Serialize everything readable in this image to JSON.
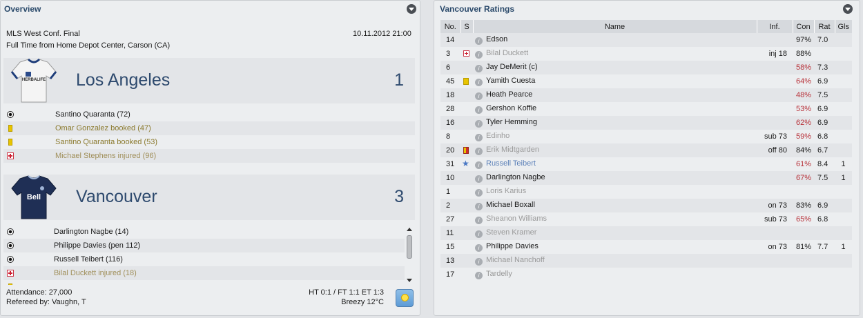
{
  "overview": {
    "title": "Overview",
    "competition": "MLS West Conf. Final",
    "datetime": "10.11.2012 21:00",
    "result_text": "Full Time from Home Depot Center, Carson (CA)",
    "home": {
      "name": "Los Angeles",
      "score": "1",
      "kit_text": "HERBALIFE",
      "events": [
        {
          "type": "goal",
          "text": "Santino Quaranta (72)"
        },
        {
          "type": "booking",
          "text": "Omar Gonzalez booked (47)"
        },
        {
          "type": "booking",
          "text": "Santino Quaranta booked (53)"
        },
        {
          "type": "injury",
          "text": "Michael Stephens injured (96)"
        }
      ]
    },
    "away": {
      "name": "Vancouver",
      "score": "3",
      "kit_text": "Bell",
      "events": [
        {
          "type": "goal",
          "text": "Darlington Nagbe (14)"
        },
        {
          "type": "goal",
          "text": "Philippe Davies (pen 112)"
        },
        {
          "type": "goal",
          "text": "Russell Teibert (116)"
        },
        {
          "type": "injury",
          "text": "Bilal Duckett injured (18)"
        }
      ]
    },
    "attendance": "Attendance: 27,000",
    "referee": "Refereed by: Vaughn, T",
    "scoreline": "HT 0:1 / FT 1:1 ET 1:3",
    "weather": "Breezy 12°C",
    "weather_icon": "sun-icon"
  },
  "ratings": {
    "title": "Vancouver Ratings",
    "columns": [
      "No.",
      "S",
      "Name",
      "Inf.",
      "Con",
      "Rat",
      "Gls"
    ],
    "rows": [
      {
        "no": "14",
        "s": "",
        "name": "Edson",
        "inf": "",
        "con": "97%",
        "rat": "7.0",
        "gls": "",
        "dim": false,
        "low": false
      },
      {
        "no": "3",
        "s": "injury",
        "name": "Bilal Duckett",
        "inf": "inj 18",
        "con": "88%",
        "rat": "",
        "gls": "",
        "dim": true,
        "low": false
      },
      {
        "no": "6",
        "s": "",
        "name": "Jay DeMerit (c)",
        "inf": "",
        "con": "58%",
        "rat": "7.3",
        "gls": "",
        "dim": false,
        "low": true
      },
      {
        "no": "45",
        "s": "yellow",
        "name": "Yamith Cuesta",
        "inf": "",
        "con": "64%",
        "rat": "6.9",
        "gls": "",
        "dim": false,
        "low": true
      },
      {
        "no": "18",
        "s": "",
        "name": "Heath Pearce",
        "inf": "",
        "con": "48%",
        "rat": "7.5",
        "gls": "",
        "dim": false,
        "low": true
      },
      {
        "no": "28",
        "s": "",
        "name": "Gershon Koffie",
        "inf": "",
        "con": "53%",
        "rat": "6.9",
        "gls": "",
        "dim": false,
        "low": true
      },
      {
        "no": "16",
        "s": "",
        "name": "Tyler Hemming",
        "inf": "",
        "con": "62%",
        "rat": "6.9",
        "gls": "",
        "dim": false,
        "low": true
      },
      {
        "no": "8",
        "s": "",
        "name": "Edinho",
        "inf": "sub 73",
        "con": "59%",
        "rat": "6.8",
        "gls": "",
        "dim": true,
        "low": true
      },
      {
        "no": "20",
        "s": "yellow-red",
        "name": "Erik Midtgarden",
        "inf": "off 80",
        "con": "84%",
        "rat": "6.7",
        "gls": "",
        "dim": true,
        "low": false
      },
      {
        "no": "31",
        "s": "star",
        "name": "Russell Teibert",
        "inf": "",
        "con": "61%",
        "rat": "8.4",
        "gls": "1",
        "dim": false,
        "low": true,
        "motm": true
      },
      {
        "no": "10",
        "s": "",
        "name": "Darlington Nagbe",
        "inf": "",
        "con": "67%",
        "rat": "7.5",
        "gls": "1",
        "dim": false,
        "low": true
      },
      {
        "no": "1",
        "s": "",
        "name": "Loris Karius",
        "inf": "",
        "con": "",
        "rat": "",
        "gls": "",
        "dim": true,
        "low": false
      },
      {
        "no": "2",
        "s": "",
        "name": "Michael Boxall",
        "inf": "on 73",
        "con": "83%",
        "rat": "6.9",
        "gls": "",
        "dim": false,
        "low": false
      },
      {
        "no": "27",
        "s": "",
        "name": "Sheanon Williams",
        "inf": "sub 73",
        "con": "65%",
        "rat": "6.8",
        "gls": "",
        "dim": true,
        "low": true
      },
      {
        "no": "11",
        "s": "",
        "name": "Steven Kramer",
        "inf": "",
        "con": "",
        "rat": "",
        "gls": "",
        "dim": true,
        "low": false
      },
      {
        "no": "15",
        "s": "",
        "name": "Philippe Davies",
        "inf": "on 73",
        "con": "81%",
        "rat": "7.7",
        "gls": "1",
        "dim": false,
        "low": false
      },
      {
        "no": "13",
        "s": "",
        "name": "Michael Nanchoff",
        "inf": "",
        "con": "",
        "rat": "",
        "gls": "",
        "dim": true,
        "low": false
      },
      {
        "no": "17",
        "s": "",
        "name": "Tardelly",
        "inf": "",
        "con": "",
        "rat": "",
        "gls": "",
        "dim": true,
        "low": false
      }
    ]
  },
  "colors": {
    "team_text": "#2e4a6e",
    "low_condition": "#b8323a",
    "motm": "#5b80b8"
  }
}
